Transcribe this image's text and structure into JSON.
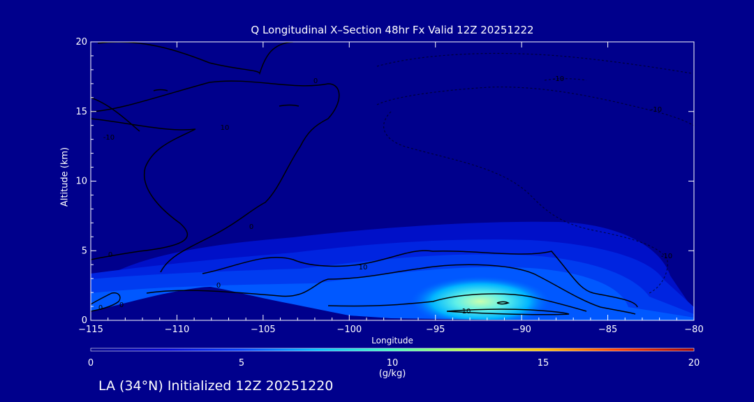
{
  "chart_data": {
    "type": "heatmap",
    "title": "Q Longitudinal X–Section 48hr  Fx Valid 12Z 20251222",
    "xlabel": "Longitude",
    "ylabel": "Altitude (km)",
    "xlim": [
      -115,
      -80
    ],
    "ylim": [
      0,
      20
    ],
    "xticks": [
      "-115",
      "-110",
      "-105",
      "-100",
      "-95",
      "-90",
      "-85",
      "-80"
    ],
    "yticks": [
      "0",
      "5",
      "10",
      "15",
      "20"
    ],
    "colorbar": {
      "label": "(g/kg)",
      "range": [
        0,
        20
      ],
      "ticks": [
        "0",
        "5",
        "10",
        "15",
        "20"
      ]
    },
    "contour_labels": [
      "0",
      "10",
      "-10",
      "0",
      "10",
      "0",
      "-10",
      "0",
      "-10",
      "10",
      "-10",
      "0",
      "0"
    ],
    "moisture_maxima": [
      {
        "lon": -92,
        "alt_km": 0.5,
        "q_gkg": 10
      },
      {
        "lon": -97,
        "alt_km": 2.0,
        "q_gkg": 5
      },
      {
        "lon": -105,
        "alt_km": 4.0,
        "q_gkg": 2
      }
    ],
    "terrain_peak": {
      "lon": -108.5,
      "alt_km": 2.0
    }
  },
  "footer": "LA (34°N) Initialized 12Z 20251220",
  "colors": {
    "background": "#00008c",
    "text": "#ffffff",
    "contour": "#000000",
    "colormap": [
      "#00008c",
      "#0000d6",
      "#0040ff",
      "#00c0ff",
      "#40ffc0",
      "#c0ff40",
      "#ffc000",
      "#ff4000",
      "#a00000"
    ]
  }
}
